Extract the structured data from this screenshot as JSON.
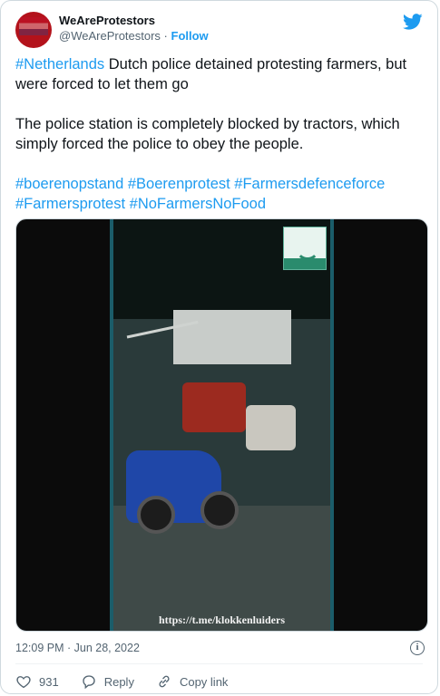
{
  "author": {
    "display_name": "WeAreProtestors",
    "handle": "@WeAreProtestors",
    "separator": " · ",
    "follow_label": "Follow"
  },
  "tweet": {
    "line1_tag": "#Netherlands",
    "line1_text": " Dutch police detained protesting farmers, but were forced to let them go",
    "paragraph2": "The police station is completely blocked by tractors, which simply forced the police to obey the people.",
    "hashtags": [
      "#boerenopstand",
      "#Boerenprotest",
      "#Farmersdefenceforce",
      "#Farmersprotest",
      "#NoFarmersNoFood"
    ]
  },
  "media": {
    "watermark": "https://t.me/klokkenluiders"
  },
  "timestamp": "12:09 PM · Jun 28, 2022",
  "actions": {
    "likes": "931",
    "reply_label": "Reply",
    "copy_label": "Copy link"
  },
  "colors": {
    "link": "#1d9bf0",
    "muted": "#536471",
    "text": "#0f1419"
  },
  "icons": [
    "avatar",
    "twitter-bird-icon",
    "info-icon",
    "heart-icon",
    "reply-icon",
    "link-icon"
  ]
}
